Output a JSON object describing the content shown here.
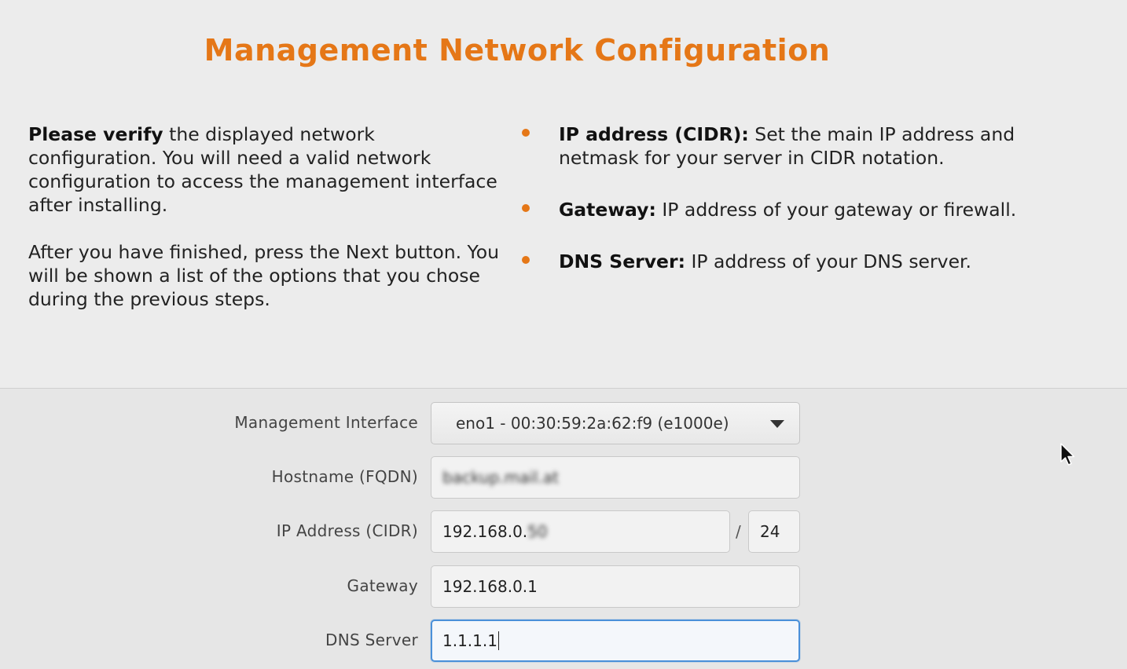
{
  "header": {
    "title": "Management Network Configuration"
  },
  "intro": {
    "p1_bold": "Please verify",
    "p1_rest": " the displayed network configuration. You will need a valid network configuration to access the management interface after installing.",
    "p2": "After you have finished, press the Next button. You will be shown a list of the options that you chose during the previous steps."
  },
  "help": {
    "items": [
      {
        "term": "IP address (CIDR):",
        "desc": " Set the main IP address and netmask for your server in CIDR notation."
      },
      {
        "term": "Gateway:",
        "desc": " IP address of your gateway or firewall."
      },
      {
        "term": "DNS Server:",
        "desc": " IP address of your DNS server."
      }
    ]
  },
  "form": {
    "interface": {
      "label": "Management Interface",
      "value": "eno1 - 00:30:59:2a:62:f9 (e1000e)"
    },
    "hostname": {
      "label": "Hostname (FQDN)",
      "value": "backup.mail.at"
    },
    "ip": {
      "label": "IP Address (CIDR)",
      "value_prefix": "192.168.0.",
      "value_obscured": "50",
      "slash": "/",
      "cidr": "24"
    },
    "gateway": {
      "label": "Gateway",
      "value": "192.168.0.1"
    },
    "dns": {
      "label": "DNS Server",
      "value": "1.1.1.1"
    }
  },
  "colors": {
    "accent": "#e57717",
    "focus": "#4a90d9"
  },
  "icons": {
    "bullet": "bullet-dot-icon",
    "dropdown": "chevron-down-icon",
    "pointer": "mouse-pointer-icon"
  }
}
